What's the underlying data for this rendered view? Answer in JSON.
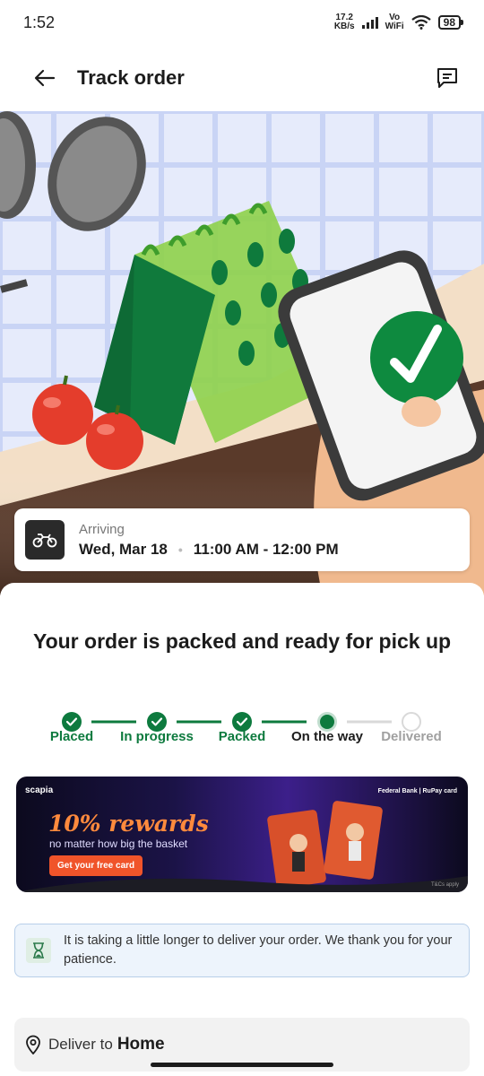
{
  "status_bar": {
    "time": "1:52",
    "net_speed_value": "17.2",
    "net_speed_unit": "KB/s",
    "vowifi_top": "Vo",
    "vowifi_bottom": "WiFi",
    "battery": "98"
  },
  "header": {
    "title": "Track order",
    "back_icon": "arrow-left-icon",
    "chat_icon": "chat-icon"
  },
  "arrival": {
    "label": "Arriving",
    "date": "Wed, Mar 18",
    "separator": "•",
    "time_window": "11:00 AM - 12:00 PM",
    "icon": "motorbike-icon"
  },
  "order_status": {
    "title": "Your order is packed and ready for pick up",
    "steps": [
      {
        "label": "Placed",
        "state": "done"
      },
      {
        "label": "In progress",
        "state": "done"
      },
      {
        "label": "Packed",
        "state": "done"
      },
      {
        "label": "On the way",
        "state": "current"
      },
      {
        "label": "Delivered",
        "state": "pending"
      }
    ]
  },
  "banner": {
    "brand": "scapia",
    "partner": "Federal Bank | RuPay card",
    "headline": "10% rewards",
    "subtext": "no matter how big the basket",
    "cta": "Get your free card",
    "terms": "T&Cs apply"
  },
  "notice": {
    "text": "It is taking a little longer to deliver your order. We thank you for your patience.",
    "icon": "hourglass-icon"
  },
  "delivery": {
    "label": "Deliver to",
    "value": "Home",
    "icon": "location-pin-icon"
  },
  "colors": {
    "done_green": "#0d7a3e",
    "pending_grey": "#d9d9d9",
    "notice_bg": "#edf4fc",
    "notice_border": "#b8cfe9",
    "cta_orange": "#f0542a",
    "headline_orange": "#ff8a3d"
  }
}
